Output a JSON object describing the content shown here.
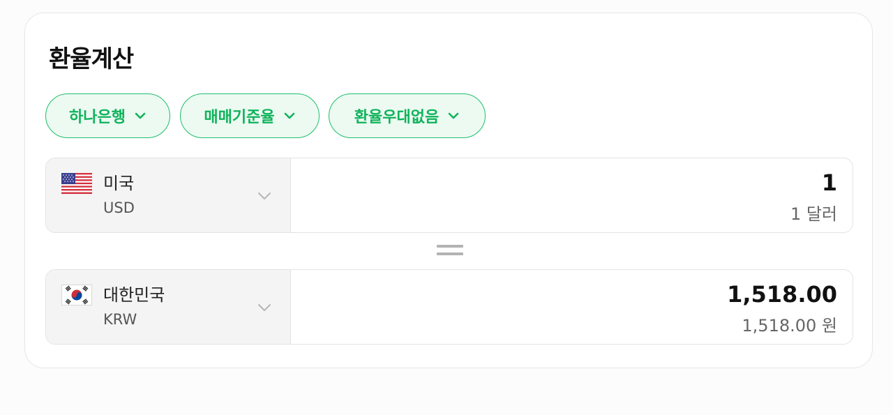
{
  "title": "환율계산",
  "chips": [
    {
      "label": "하나은행"
    },
    {
      "label": "매매기준율"
    },
    {
      "label": "환율우대없음"
    }
  ],
  "from": {
    "country": "미국",
    "code": "USD",
    "flag_icon": "us-flag-icon",
    "value": "1",
    "value_text": "1 달러"
  },
  "to": {
    "country": "대한민국",
    "code": "KRW",
    "flag_icon": "kr-flag-icon",
    "value": "1,518.00",
    "value_text": "1,518.00 원"
  },
  "colors": {
    "accent": "#0fb35a",
    "chip_bg": "#ecfaf2",
    "panel_bg": "#f4f4f4"
  }
}
